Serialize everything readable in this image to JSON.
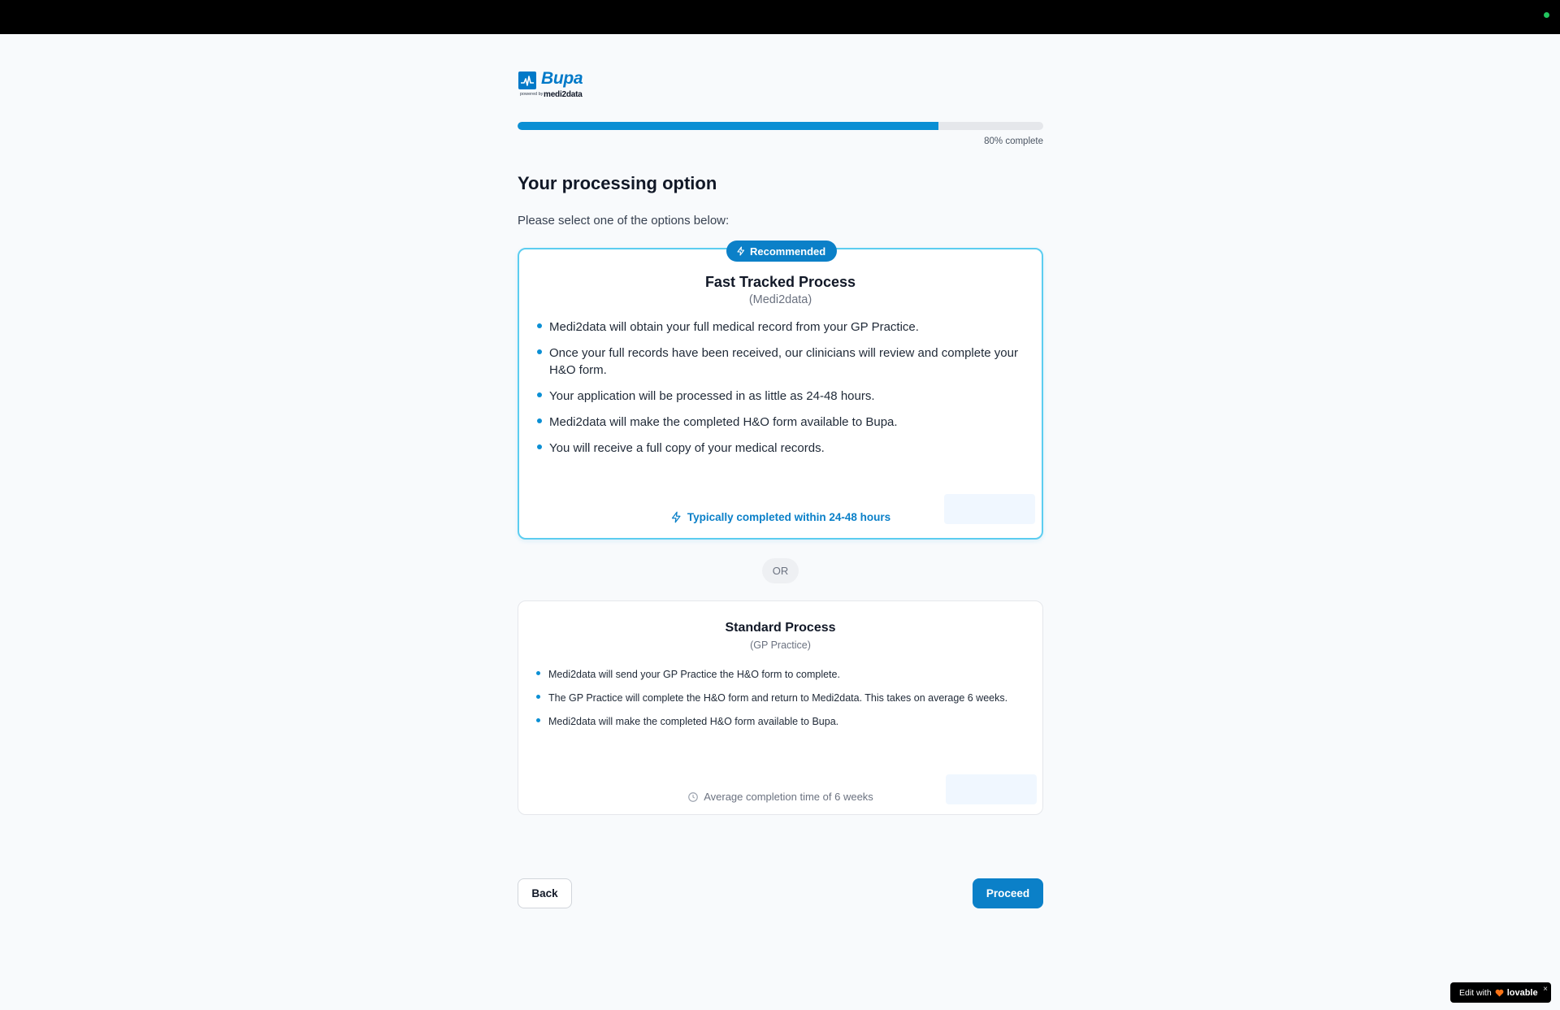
{
  "brand": {
    "name": "Bupa",
    "powered_by": "powered by",
    "partner": "medi2data",
    "color": "#0079c8"
  },
  "progress": {
    "percent": 80,
    "label": "80% complete"
  },
  "page": {
    "title": "Your processing option",
    "instructions": "Please select one of the options below:"
  },
  "fast_track": {
    "badge": "Recommended",
    "badge_icon": "lightning-icon",
    "title": "Fast Tracked Process",
    "subtitle": "(Medi2data)",
    "items": [
      "Medi2data will obtain your full medical record from your GP Practice.",
      "Once your full records have been received, our clinicians will review and complete your H&O form.",
      "Your application will be processed in as little as 24-48 hours.",
      "Medi2data will make the completed H&O form available to Bupa.",
      "You will receive a full copy of your medical records."
    ],
    "timing": "Typically completed within 24-48 hours",
    "timing_icon": "lightning-icon"
  },
  "separator": "OR",
  "standard": {
    "title": "Standard Process",
    "subtitle": "(GP Practice)",
    "items": [
      "Medi2data will send your GP Practice the H&O form to complete.",
      "The GP Practice will complete the H&O form and return to Medi2data. This takes on average 6 weeks.",
      "Medi2data will make the completed H&O form available to Bupa."
    ],
    "timing": "Average completion time of 6 weeks",
    "timing_icon": "clock-icon"
  },
  "actions": {
    "back": "Back",
    "proceed": "Proceed"
  },
  "lovable_badge": {
    "prefix": "Edit with",
    "brand": "lovable",
    "close": "×"
  },
  "colors": {
    "accent": "#0b80c8",
    "progress_fill": "#0b8fd4",
    "recommended_border": "#5ccdf0",
    "page_bg": "#f8fafc"
  }
}
